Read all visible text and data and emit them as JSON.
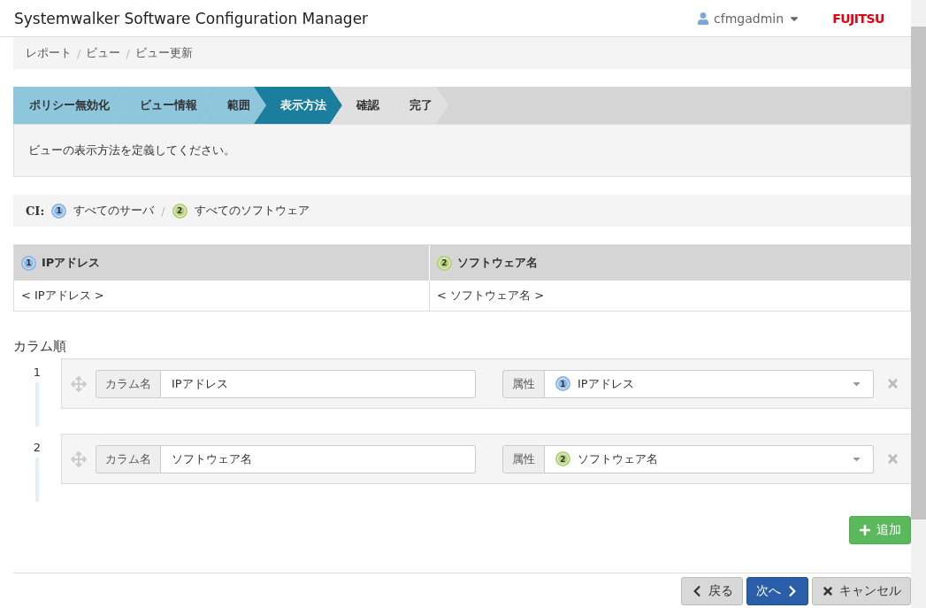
{
  "app": {
    "title": "Systemwalker Software Configuration Manager",
    "user": "cfmgadmin",
    "logo": "FUJITSU"
  },
  "breadcrumb": [
    "レポート",
    "ビュー",
    "ビュー更新"
  ],
  "breadcrumb_separator": "/",
  "steps": [
    {
      "label": "ポリシー無効化",
      "done": true,
      "selected": false
    },
    {
      "label": "ビュー情報",
      "done": true,
      "selected": false
    },
    {
      "label": "範囲",
      "done": true,
      "selected": false
    },
    {
      "label": "表示方法",
      "done": false,
      "selected": true
    },
    {
      "label": "確認",
      "done": false,
      "selected": false
    },
    {
      "label": "完了",
      "done": false,
      "selected": false
    }
  ],
  "instruction": "ビューの表示方法を定義してください。",
  "ci": {
    "label": "CI:",
    "separator": "/",
    "items": [
      {
        "number": "1",
        "name": "すべてのサーバ",
        "color": "#8bb8e8"
      },
      {
        "number": "2",
        "name": "すべてのソフトウェア",
        "color": "#b5d17a"
      }
    ]
  },
  "preview": {
    "columns": [
      {
        "number": "1",
        "title": "IPアドレス",
        "color": "#8bb8e8",
        "value": "< IPアドレス >"
      },
      {
        "number": "2",
        "title": "ソフトウェア名",
        "color": "#b5d17a",
        "value": "< ソフトウェア名 >"
      }
    ]
  },
  "column_order": {
    "title": "カラム順",
    "rows": [
      {
        "index": "1",
        "name_label": "カラム名",
        "name": "IPアドレス",
        "attr_label": "属性",
        "attr_number": "1",
        "attr": "IPアドレス",
        "color": "#8bb8e8"
      },
      {
        "index": "2",
        "name_label": "カラム名",
        "name": "ソフトウェア名",
        "attr_label": "属性",
        "attr_number": "2",
        "attr": "ソフトウェア名",
        "color": "#b5d17a"
      }
    ],
    "add_button": "追加"
  },
  "footer": {
    "back": "戻る",
    "next": "次へ",
    "cancel": "キャンセル"
  }
}
